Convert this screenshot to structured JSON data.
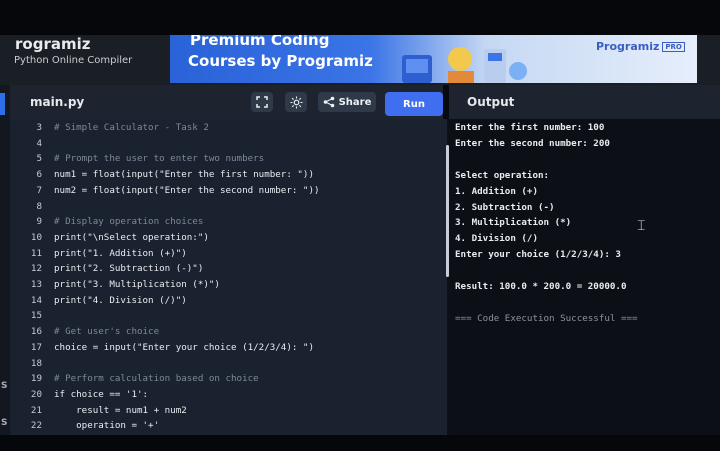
{
  "header": {
    "brand": "rogramiz",
    "subtitle": "Python Online Compiler",
    "banner_line1": "Premium Coding",
    "banner_line2": "Courses by Programiz",
    "banner_logo": "Programiz",
    "banner_pro": "PRO"
  },
  "left_edge": {
    "s1": "S",
    "s2": "S"
  },
  "editor": {
    "filename": "main.py",
    "share_label": "Share",
    "run_label": "Run",
    "lines": [
      {
        "n": "3",
        "text": "# Simple Calculator - Task 2",
        "kind": "comment"
      },
      {
        "n": "4",
        "text": "",
        "kind": "default"
      },
      {
        "n": "5",
        "text": "# Prompt the user to enter two numbers",
        "kind": "comment"
      },
      {
        "n": "6",
        "text": "num1 = float(input(\"Enter the first number: \"))",
        "kind": "default"
      },
      {
        "n": "7",
        "text": "num2 = float(input(\"Enter the second number: \"))",
        "kind": "default"
      },
      {
        "n": "8",
        "text": "",
        "kind": "default"
      },
      {
        "n": "9",
        "text": "# Display operation choices",
        "kind": "comment"
      },
      {
        "n": "10",
        "text": "print(\"\\nSelect operation:\")",
        "kind": "default"
      },
      {
        "n": "11",
        "text": "print(\"1. Addition (+)\")",
        "kind": "default"
      },
      {
        "n": "12",
        "text": "print(\"2. Subtraction (-)\")",
        "kind": "default"
      },
      {
        "n": "13",
        "text": "print(\"3. Multiplication (*)\")",
        "kind": "default"
      },
      {
        "n": "14",
        "text": "print(\"4. Division (/)\")",
        "kind": "default"
      },
      {
        "n": "15",
        "text": "",
        "kind": "default"
      },
      {
        "n": "16",
        "text": "# Get user's choice",
        "kind": "comment"
      },
      {
        "n": "17",
        "text": "choice = input(\"Enter your choice (1/2/3/4): \")",
        "kind": "default"
      },
      {
        "n": "18",
        "text": "",
        "kind": "default"
      },
      {
        "n": "19",
        "text": "# Perform calculation based on choice",
        "kind": "comment"
      },
      {
        "n": "20",
        "text": "if choice == '1':",
        "kind": "default"
      },
      {
        "n": "21",
        "text": "    result = num1 + num2",
        "kind": "default"
      },
      {
        "n": "22",
        "text": "    operation = '+'",
        "kind": "default"
      }
    ]
  },
  "output": {
    "title": "Output",
    "lines": [
      {
        "text": "Enter the first number: 100",
        "kind": "plain"
      },
      {
        "text": "Enter the second number: 200",
        "kind": "plain"
      },
      {
        "text": "",
        "kind": "plain"
      },
      {
        "text": "Select operation:",
        "kind": "plain"
      },
      {
        "text": "1. Addition (+)",
        "kind": "plain"
      },
      {
        "text": "2. Subtraction (-)",
        "kind": "plain"
      },
      {
        "text": "3. Multiplication (*)",
        "kind": "plain"
      },
      {
        "text": "4. Division (/)",
        "kind": "plain"
      },
      {
        "text": "Enter your choice (1/2/3/4): 3",
        "kind": "plain"
      },
      {
        "text": "",
        "kind": "plain"
      },
      {
        "text": "Result: 100.0 * 200.0 = 20000.0",
        "kind": "plain"
      },
      {
        "text": "",
        "kind": "plain"
      },
      {
        "text": "=== Code Execution Successful ===",
        "kind": "ok"
      }
    ]
  },
  "colors": {
    "accent": "#3f6ff0",
    "editor_bg": "#1a2230",
    "output_bg": "#0c1016",
    "comment": "#7f8896",
    "string": "#e9d8a6"
  }
}
